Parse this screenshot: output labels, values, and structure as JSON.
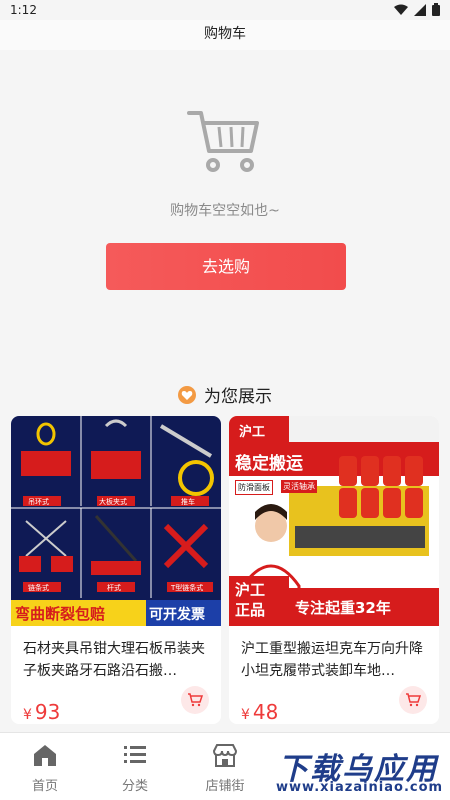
{
  "status_bar": {
    "time": "1:12",
    "icons": [
      "wifi-icon",
      "signal-icon",
      "battery-icon"
    ]
  },
  "header": {
    "title": "购物车"
  },
  "empty_state": {
    "icon": "cart-icon",
    "message": "购物车空空如也~",
    "button_label": "去选购"
  },
  "recommend": {
    "title": "为您展示",
    "icon": "heart-icon"
  },
  "products": [
    {
      "title": "石材夹具吊钳大理石板吊装夹子板夹路牙石路沿石搬…",
      "price": "93",
      "currency": "¥",
      "image_labels": [
        "吊环式",
        "大板夹式",
        "推车",
        "链条式",
        "杆式",
        "T型链条式"
      ],
      "banner_left": "弯曲断裂包赔",
      "banner_right": "可开发票"
    },
    {
      "title": "沪工重型搬运坦克车万向升降小坦克履带式装卸车地…",
      "price": "48",
      "currency": "¥",
      "brand": "沪工",
      "headline": "稳定搬运",
      "tag_1": "防滑面板",
      "tag_2": "灵活轴承",
      "badge": "沪工\n正品",
      "slogan": "专注起重32年"
    }
  ],
  "tabbar": {
    "items": [
      {
        "label": "首页",
        "icon": "home-icon"
      },
      {
        "label": "分类",
        "icon": "list-icon"
      },
      {
        "label": "店铺街",
        "icon": "store-icon"
      }
    ]
  },
  "watermark": {
    "main": "下载乌应用",
    "sub": "www.xiazainiao.com"
  },
  "colors": {
    "accent": "#f24c4c",
    "price": "#ee3a3a",
    "heart": "#f39a43",
    "watermark": "#1f3d8a"
  }
}
